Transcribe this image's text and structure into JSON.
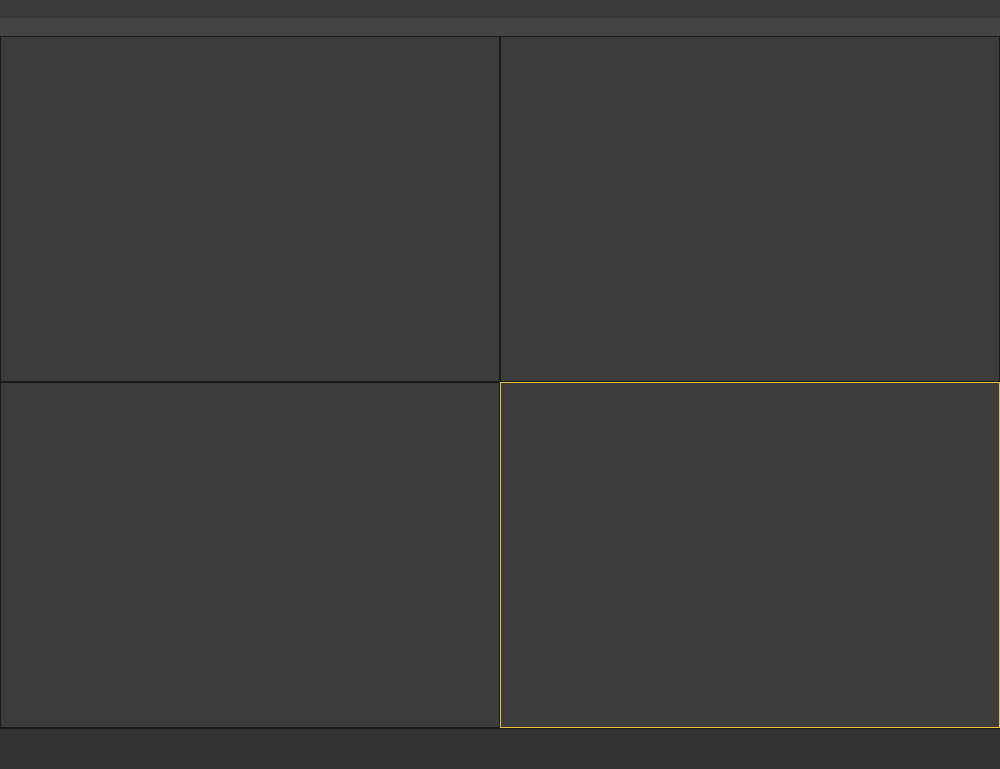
{
  "window": {
    "title": ""
  },
  "menu": [],
  "viewports": [
    {
      "label": ""
    },
    {
      "label": ""
    },
    {
      "label": ""
    },
    {
      "label": ""
    }
  ],
  "timeline": {
    "frame_label": ""
  }
}
